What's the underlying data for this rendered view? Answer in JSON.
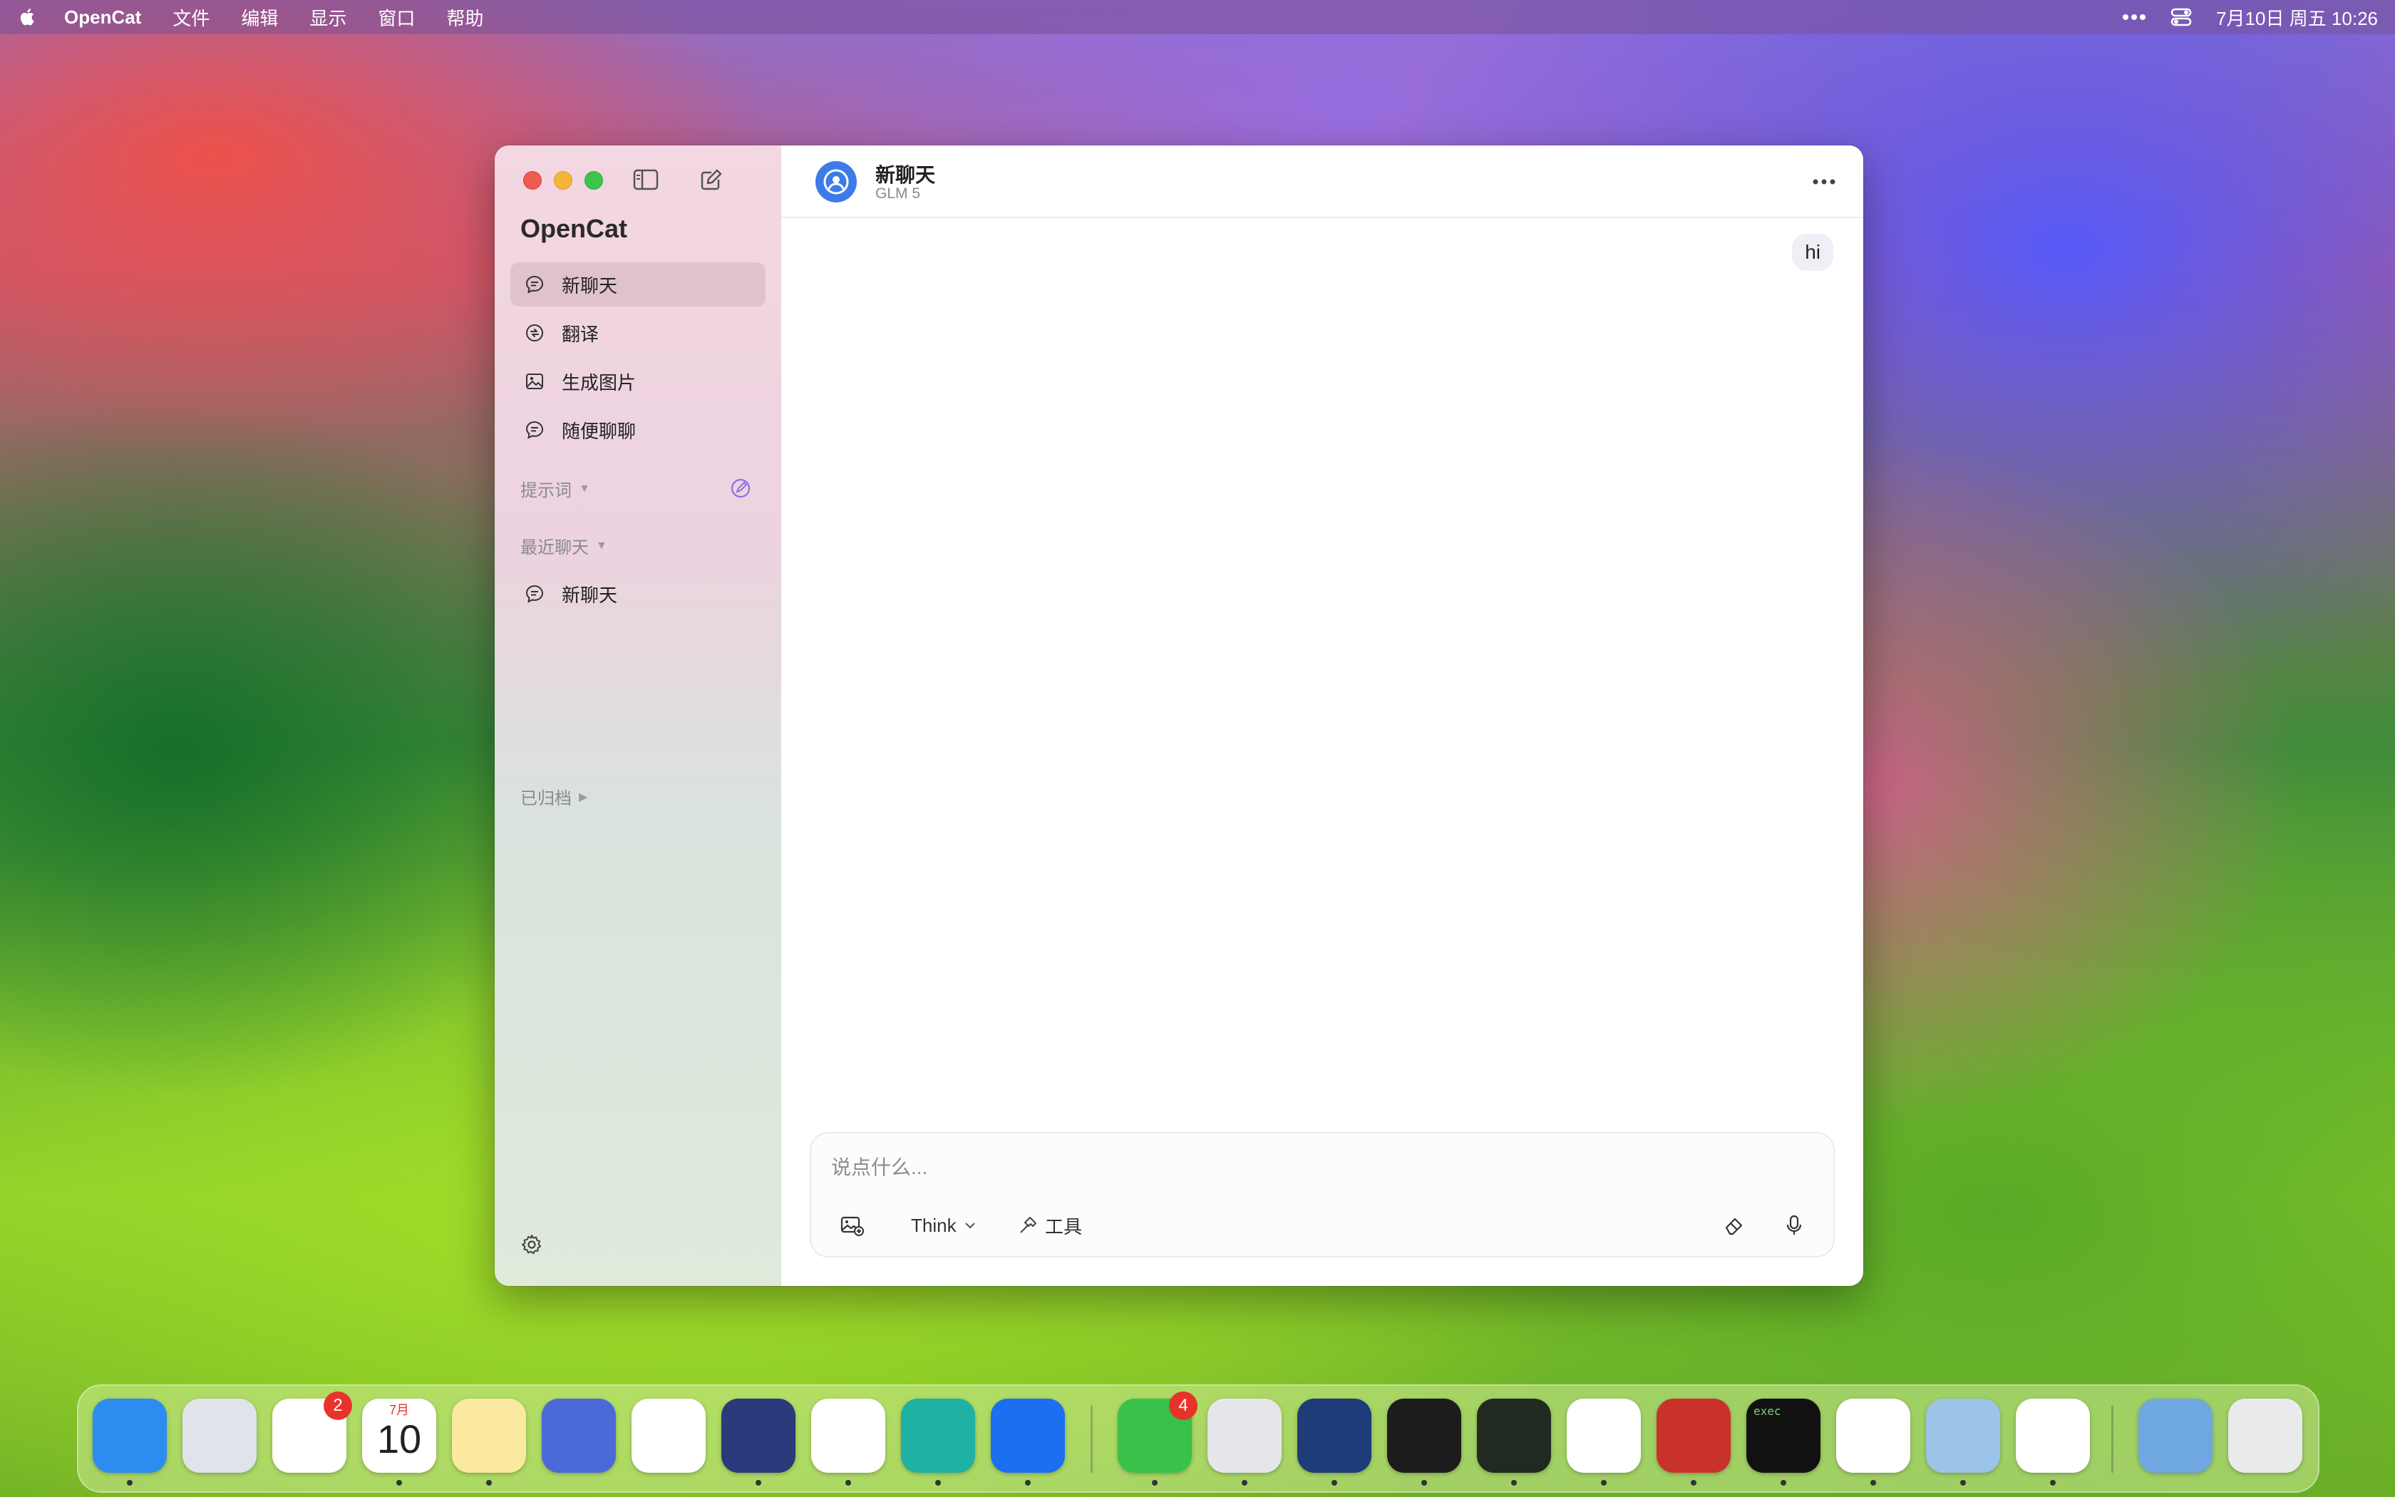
{
  "menubar": {
    "app_name": "OpenCat",
    "items": [
      "文件",
      "编辑",
      "显示",
      "窗口",
      "帮助"
    ],
    "clock": "7月10日 周五  10:26"
  },
  "sidebar": {
    "title": "OpenCat",
    "nav": [
      {
        "label": "新聊天",
        "icon": "chat-bubble-icon",
        "active": true
      },
      {
        "label": "翻译",
        "icon": "translate-icon",
        "active": false
      },
      {
        "label": "生成图片",
        "icon": "image-icon",
        "active": false
      },
      {
        "label": "随便聊聊",
        "icon": "chat-bubble-icon",
        "active": false
      }
    ],
    "sections": {
      "prompts": "提示词",
      "recent": "最近聊天",
      "archived": "已归档"
    },
    "recent_chats": [
      {
        "label": "新聊天"
      }
    ]
  },
  "chat": {
    "title": "新聊天",
    "model": "GLM 5",
    "messages": [
      {
        "role": "user",
        "text": "hi"
      }
    ]
  },
  "composer": {
    "placeholder": "说点什么...",
    "think_label": "Think",
    "tools_label": "工具"
  },
  "dock": {
    "apps": [
      {
        "name": "finder",
        "color": "#2d8cf0",
        "badge": null
      },
      {
        "name": "launchpad",
        "color": "#dfe3ea",
        "badge": null
      },
      {
        "name": "photos",
        "color": "#ffffff",
        "badge": "2"
      },
      {
        "name": "calendar",
        "color": "#ffffff",
        "badge": null,
        "month": "7月",
        "day": "10"
      },
      {
        "name": "notes",
        "color": "#fbe9a0",
        "badge": null
      },
      {
        "name": "transmit",
        "color": "#4b6ad8",
        "badge": null
      },
      {
        "name": "freeform",
        "color": "#ffffff",
        "badge": null
      },
      {
        "name": "rocket",
        "color": "#2a3a7a",
        "badge": null
      },
      {
        "name": "chrome",
        "color": "#ffffff",
        "badge": null
      },
      {
        "name": "edge",
        "color": "#1fb1a3",
        "badge": null
      },
      {
        "name": "proxyman",
        "color": "#1c6ff0",
        "badge": null
      },
      {
        "name": "wechat",
        "color": "#39c24a",
        "badge": "4"
      },
      {
        "name": "printer",
        "color": "#e6e6ea",
        "badge": null
      },
      {
        "name": "migration",
        "color": "#1e3c78",
        "badge": null
      },
      {
        "name": "terminal",
        "color": "#1c1c1c",
        "badge": null
      },
      {
        "name": "activity-monitor",
        "color": "#202a20",
        "badge": null
      },
      {
        "name": "qq",
        "color": "#ffffff",
        "badge": null
      },
      {
        "name": "game",
        "color": "#c9322a",
        "badge": null
      },
      {
        "name": "exec",
        "color": "#111111",
        "badge": null,
        "label": "exec"
      },
      {
        "name": "baidu-netdisk",
        "color": "#ffffff",
        "badge": null
      },
      {
        "name": "preview",
        "color": "#9cc3e8",
        "badge": null
      },
      {
        "name": "eye-app",
        "color": "#ffffff",
        "badge": null
      },
      {
        "name": "downloads-folder",
        "color": "#6fa8e0",
        "badge": null
      },
      {
        "name": "trash",
        "color": "#e8eaec",
        "badge": null
      }
    ]
  },
  "colors": {
    "accent": "#3d7ce8",
    "close": "#ee5b52",
    "minimize": "#f5b53a",
    "zoom": "#3dc44c",
    "prompt_icon": "#8a6fe8"
  }
}
